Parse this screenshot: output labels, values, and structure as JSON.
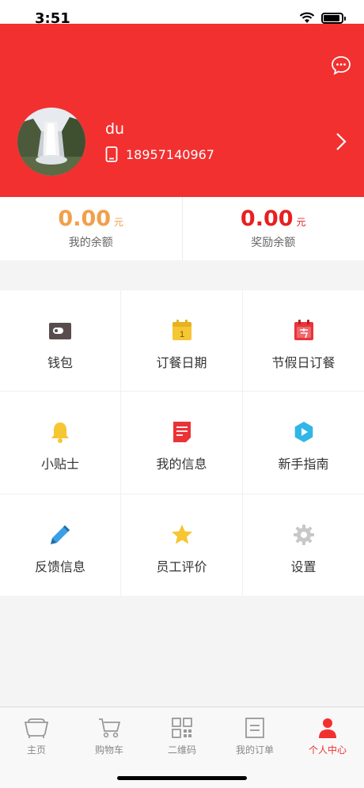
{
  "status": {
    "time": "3:51"
  },
  "profile": {
    "name": "du",
    "phone": "18957140967"
  },
  "balances": [
    {
      "value": "0.00",
      "unit": "元",
      "label": "我的余额",
      "color": "#f29f4a"
    },
    {
      "value": "0.00",
      "unit": "元",
      "label": "奖励余额",
      "color": "#e81f1f"
    }
  ],
  "grid": [
    {
      "label": "钱包",
      "icon": "wallet-icon"
    },
    {
      "label": "订餐日期",
      "icon": "calendar-icon"
    },
    {
      "label": "节假日订餐",
      "icon": "holiday-calendar-icon"
    },
    {
      "label": "小贴士",
      "icon": "bell-icon"
    },
    {
      "label": "我的信息",
      "icon": "document-icon"
    },
    {
      "label": "新手指南",
      "icon": "play-icon"
    },
    {
      "label": "反馈信息",
      "icon": "pencil-icon"
    },
    {
      "label": "员工评价",
      "icon": "star-icon"
    },
    {
      "label": "设置",
      "icon": "gear-icon"
    }
  ],
  "tabs": [
    {
      "label": "主页",
      "icon": "home-icon"
    },
    {
      "label": "购物车",
      "icon": "cart-icon"
    },
    {
      "label": "二维码",
      "icon": "qrcode-icon"
    },
    {
      "label": "我的订单",
      "icon": "order-icon"
    },
    {
      "label": "个人中心",
      "icon": "person-icon",
      "active": true
    }
  ],
  "colors": {
    "header": "#f23030",
    "active_tab": "#f23030"
  }
}
